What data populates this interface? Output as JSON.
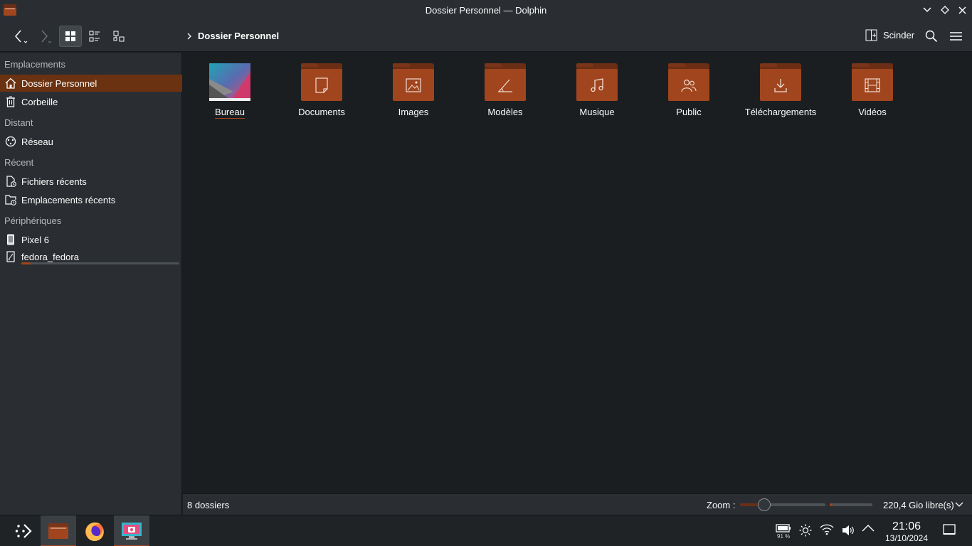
{
  "window": {
    "title": "Dossier Personnel — Dolphin",
    "icons": [
      "dolphin-folder-icon",
      "minimize-icon",
      "maximize-icon",
      "close-icon"
    ]
  },
  "toolbar": {
    "breadcrumb": [
      "Dossier Personnel"
    ],
    "split_label": "Scinder",
    "icons": [
      "back-icon",
      "forward-icon",
      "icons-view-icon",
      "details-view-icon",
      "tree-view-icon",
      "split-icon",
      "search-icon",
      "hamburger-menu-icon"
    ]
  },
  "sidebar": {
    "sections": [
      {
        "label": "Emplacements",
        "items": [
          {
            "label": "Dossier Personnel",
            "icon": "home-icon",
            "selected": true
          },
          {
            "label": "Corbeille",
            "icon": "trash-icon"
          }
        ]
      },
      {
        "label": "Distant",
        "items": [
          {
            "label": "Réseau",
            "icon": "network-icon"
          }
        ]
      },
      {
        "label": "Récent",
        "items": [
          {
            "label": "Fichiers récents",
            "icon": "recent-files-icon"
          },
          {
            "label": "Emplacements récents",
            "icon": "recent-locations-icon"
          }
        ]
      },
      {
        "label": "Périphériques",
        "items": [
          {
            "label": "Pixel 6",
            "icon": "phone-icon"
          },
          {
            "label": "fedora_fedora",
            "icon": "drive-icon",
            "capacity_fraction": 0.06
          }
        ]
      }
    ]
  },
  "files": [
    {
      "label": "Bureau",
      "icon": "desktop-thumbnail"
    },
    {
      "label": "Documents",
      "icon": "folder-documents-icon"
    },
    {
      "label": "Images",
      "icon": "folder-images-icon"
    },
    {
      "label": "Modèles",
      "icon": "folder-templates-icon"
    },
    {
      "label": "Musique",
      "icon": "folder-music-icon"
    },
    {
      "label": "Public",
      "icon": "folder-public-icon"
    },
    {
      "label": "Téléchargements",
      "icon": "folder-downloads-icon"
    },
    {
      "label": "Vidéos",
      "icon": "folder-videos-icon"
    }
  ],
  "statusbar": {
    "count": "8 dossiers",
    "zoom_label": "Zoom :",
    "zoom_fraction": 0.28,
    "free_space": "220,4 Gio libre(s)",
    "used_fraction": 0.06
  },
  "taskbar": {
    "apps": [
      "launcher-icon",
      "dolphin-icon",
      "firefox-icon",
      "screenshot-icon"
    ],
    "battery_pct": "91 %",
    "tray_icons": [
      "battery-icon",
      "brightness-icon",
      "wifi-icon",
      "volume-icon",
      "tray-expand-icon",
      "show-desktop-icon"
    ],
    "time": "21:06",
    "date": "13/10/2024"
  },
  "colors": {
    "accent": "#a0451e",
    "selection": "#6a3210",
    "panel": "#2a2e32",
    "view": "#1b1e20"
  }
}
